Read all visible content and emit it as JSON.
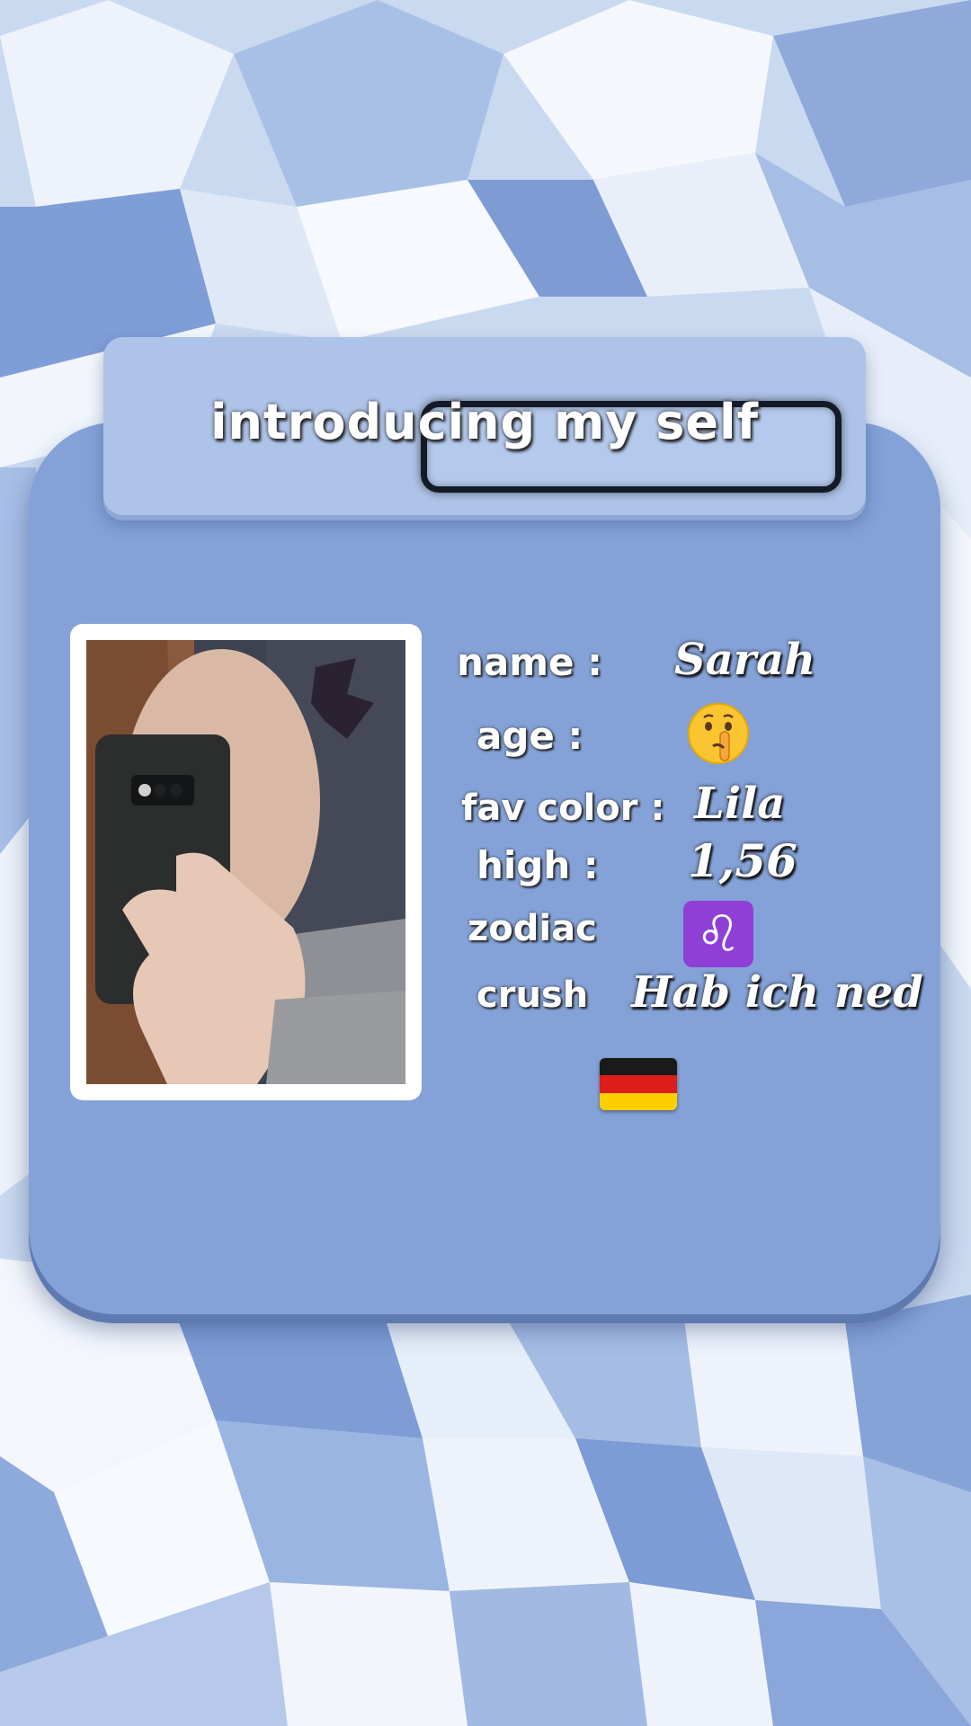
{
  "title": "introducing my self",
  "profile": {
    "name_label": "name :",
    "name_value": "Sarah",
    "age_label": "age :",
    "age_icon": "shushing-face-emoji",
    "color_label": "fav color :",
    "color_value": "Lila",
    "height_label": "high :",
    "height_value": "1,56",
    "zodiac_label": "zodiac",
    "zodiac_symbol": "♌",
    "zodiac_icon": "leo-zodiac-icon",
    "crush_label": "crush",
    "crush_value": "Hab ich ned",
    "flag_icon": "germany-flag-icon"
  },
  "colors": {
    "background": "#b9cdea",
    "card": "#84a2d8",
    "title_bar": "#aec3e8",
    "leo_box": "#8f3fd6"
  }
}
